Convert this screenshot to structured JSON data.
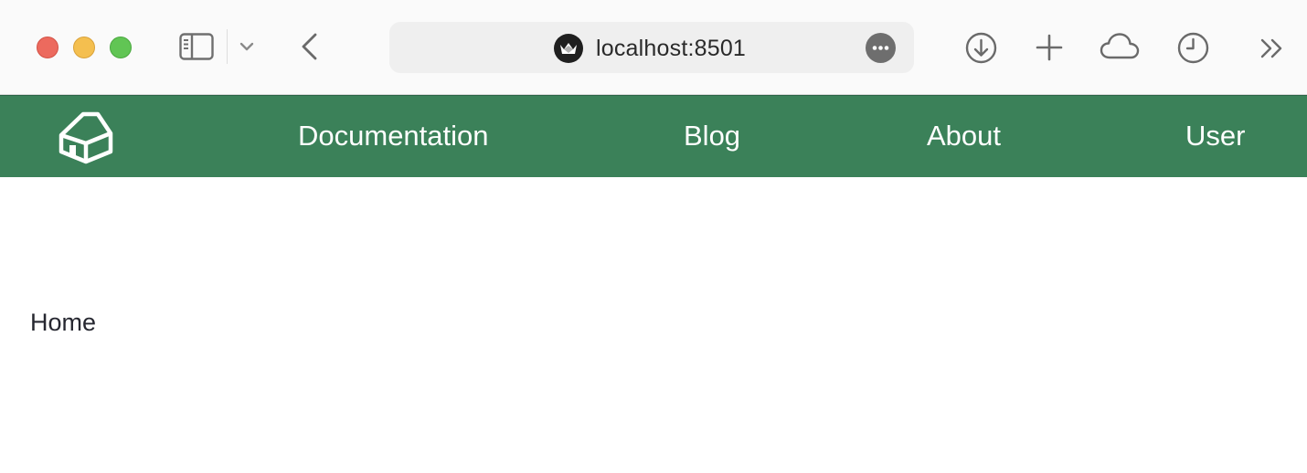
{
  "browser": {
    "url": "localhost:8501",
    "traffic_lights": [
      "close",
      "minimize",
      "maximize"
    ],
    "toolbar_icons": [
      "sidebar-icon",
      "chevron-down-icon",
      "back-icon",
      "download-icon",
      "new-tab-icon",
      "cloud-icon",
      "history-icon",
      "overflow-icon"
    ],
    "colors": {
      "close": "#ec6a5e",
      "minimize": "#f4bf4f",
      "maximize": "#61c554"
    }
  },
  "nav": {
    "background": "#3b8159",
    "home_icon": "house-icon",
    "links": [
      {
        "label": "Documentation"
      },
      {
        "label": "Blog"
      },
      {
        "label": "About"
      },
      {
        "label": "User"
      }
    ]
  },
  "main": {
    "text": "Home"
  }
}
